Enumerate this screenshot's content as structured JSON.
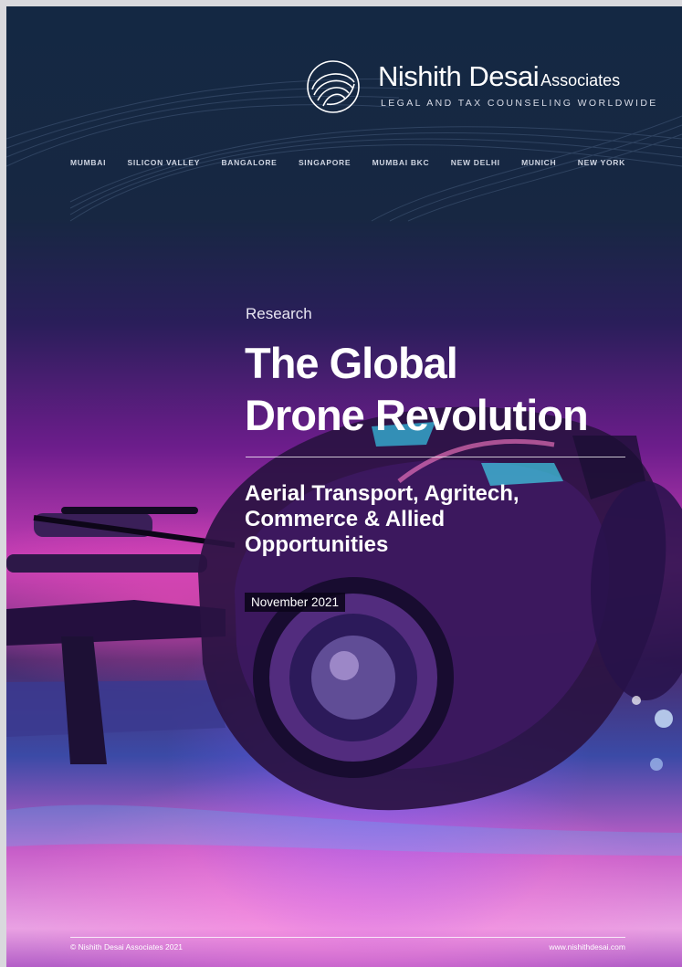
{
  "brand": {
    "name": "Nishith Desai",
    "suffix": "Associates",
    "tagline": "LEGAL AND TAX COUNSELING WORLDWIDE"
  },
  "cities": [
    "MUMBAI",
    "SILICON VALLEY",
    "BANGALORE",
    "SINGAPORE",
    "MUMBAI BKC",
    "NEW DELHI",
    "MUNICH",
    "NEW YORK"
  ],
  "cover": {
    "category": "Research",
    "title_line1": "The Global",
    "title_line2": "Drone Revolution",
    "subtitle_line1": "Aerial Transport, Agritech,",
    "subtitle_line2": "Commerce & Allied",
    "subtitle_line3": "Opportunities",
    "date": "November 2021"
  },
  "footer": {
    "copyright": "© Nishith Desai Associates 2021",
    "website": "www.nishithdesai.com"
  },
  "colors": {
    "header_navy": "#142843",
    "magenta": "#c63fb5",
    "violet": "#3b4aa6"
  }
}
